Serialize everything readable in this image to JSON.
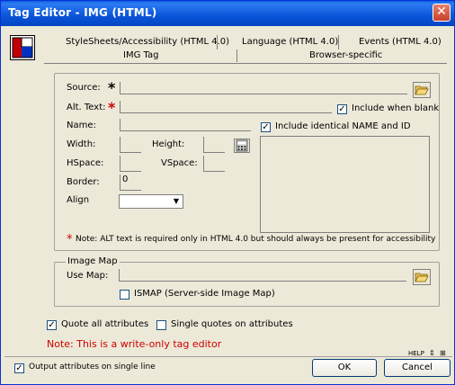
{
  "window": {
    "title": "Tag Editor - IMG   (HTML)",
    "close_glyph": "✕"
  },
  "tabs": {
    "row1": [
      "StyleSheets/Accessibility (HTML 4.0)",
      "Language (HTML 4.0)",
      "Events (HTML 4.0)"
    ],
    "row2": [
      "IMG Tag",
      "Browser-specific"
    ]
  },
  "form": {
    "source_label": "Source:",
    "source_value": "",
    "alt_label": "Alt. Text:",
    "alt_value": "",
    "name_label": "Name:",
    "width_label": "Width:",
    "height_label": "Height:",
    "hspace_label": "HSpace:",
    "vspace_label": "VSpace:",
    "border_label": "Border:",
    "border_value": "0",
    "align_label": "Align",
    "align_value": "",
    "include_when_blank_label": "Include when blank",
    "include_name_id_label": "Include identical NAME and ID",
    "required_star": "*",
    "note": "Note: ALT text is required only in HTML 4.0 but should always be present for accessibility"
  },
  "image_map": {
    "group_label": "Image Map",
    "use_map_label": "Use Map:",
    "use_map_value": "",
    "ismap_label": "ISMAP (Server-side Image Map)"
  },
  "options": {
    "quote_all_label": "Quote all attributes",
    "single_quotes_label": "Single quotes on attributes",
    "write_only_note": "Note: This is a write-only tag editor",
    "output_single_line_label": "Output attributes on single line"
  },
  "buttons": {
    "ok": "OK",
    "cancel": "Cancel",
    "help": "HELP"
  },
  "colors": {
    "title_bar": "#0a54d8",
    "note_red": "#d00000",
    "required_star_red": "#d00000"
  },
  "icons": {
    "folder": "folder-open-icon",
    "calc": "calculator-icon",
    "app": "tag-editor-icon"
  }
}
